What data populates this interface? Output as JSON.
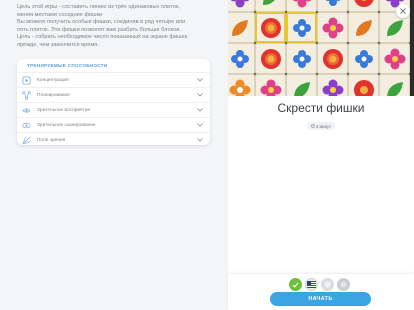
{
  "description": {
    "line1": "Цель этой игры - составить линию из трёх одинаковых плиток,",
    "line2": "меняя местами соседние фишки",
    "line3": "Вы можете получить особые фишки, соединив в ряд четыре или",
    "line4": "пять плиток. Эти фишки позволят вам разбить больше блоков.",
    "line5": "Цель - собрать необходимое число показанных на экране фишек",
    "line6": "прежде, чем закончится время."
  },
  "skills": {
    "title": "ТРЕНИРУЕМЫЕ СПОСОБНОСТИ",
    "items": [
      {
        "label": "Концентрация",
        "icon": "concentration-icon"
      },
      {
        "label": "Планирование",
        "icon": "planning-icon"
      },
      {
        "label": "Зрительное восприятие",
        "icon": "visual-perception-icon"
      },
      {
        "label": "Зрительное сканирование",
        "icon": "visual-scanning-icon"
      },
      {
        "label": "Поле зрения",
        "icon": "field-of-view-icon"
      }
    ]
  },
  "game": {
    "title": "Скрести фишки",
    "duration": "4 минут"
  },
  "start_label": "НАЧАТЬ",
  "colors": {
    "accent": "#3aa5e3",
    "skills_title": "#5b9bd5",
    "selected_tile_border": "#e6c733"
  }
}
